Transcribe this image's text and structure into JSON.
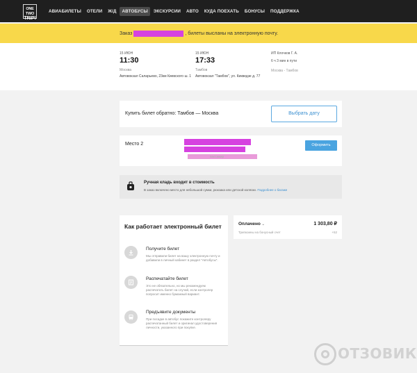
{
  "logo": {
    "line1": "ONE TWO",
    "line2": "TRIP!"
  },
  "nav": {
    "items": [
      {
        "label": "АВИАБИЛЕТЫ"
      },
      {
        "label": "ОТЕЛИ"
      },
      {
        "label": "Ж/Д"
      },
      {
        "label": "АВТОБУСЫ",
        "active": true
      },
      {
        "label": "ЭКСКУРСИИ"
      },
      {
        "label": "АВТО"
      },
      {
        "label": "КУДА ПОЕХАТЬ"
      },
      {
        "label": "БОНУСЫ"
      },
      {
        "label": "ПОДДЕРЖКА"
      }
    ]
  },
  "banner": {
    "prefix": "Заказ",
    "suffix": ", билеты высланы на электронную почту."
  },
  "trip": {
    "departure": {
      "date": "15 ИЮН",
      "time": "11:30",
      "city": "Москва",
      "station": "Автовокзал Саларьево, 23км Киевского ш. 1"
    },
    "arrival": {
      "date": "15 ИЮН",
      "time": "17:33",
      "city": "Тамбов",
      "station": "Автовокзал \"Тамбов\", ул. Кикведзе д. 77"
    },
    "carrier": "ИП Клочков Г. А.",
    "duration": "6 ч 3 мин в пути",
    "route": "Москва - Тамбов"
  },
  "return_trip": {
    "text": "Купить билет обратно: Тамбов — Москва",
    "button": "Выбрать дату"
  },
  "seat": {
    "label": "Место 2",
    "passenger_hint": "пассажир",
    "cancel_button": "Оформить"
  },
  "baggage": {
    "title": "Ручная кладь входит в стоимость",
    "desc": "В заказ включено место для небольшой сумки, рюкзака или детской коляски.",
    "link": "Подробнее о багаже"
  },
  "how_it_works": {
    "title": "Как работает электронный билет",
    "steps": [
      {
        "title": "Получите билет",
        "desc": "Мы отправили билет на вашу электронную почту и добавили в личный кабинет в раздел \"Автобусы\"."
      },
      {
        "title": "Распечатайте билет",
        "desc": "Это не обязательно, но мы рекомендуем распечатать билет на случай, если контролер попросит именно бумажный вариант."
      },
      {
        "title": "Предъявите документы",
        "desc": "При посадке в автобус покажите контролеру распечатанный билет и оригинал удостоверения личности, указанного при покупке."
      }
    ]
  },
  "payment": {
    "status": "Оплачено",
    "amount": "1 303,80 ₽",
    "bonus_label": "Трипкоины на бонусный счет",
    "bonus_value": "+52"
  },
  "watermark": {
    "text": "ОТЗОВИК"
  }
}
